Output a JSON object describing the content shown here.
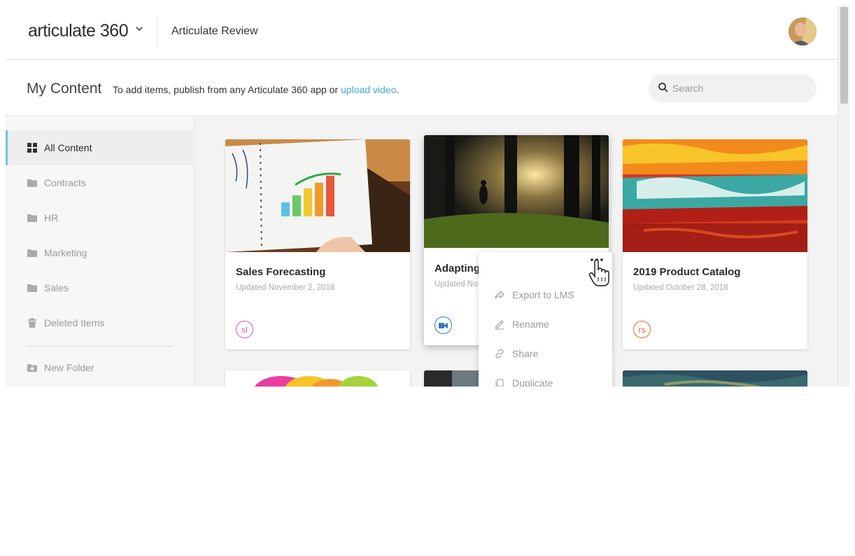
{
  "header": {
    "logo_text": "articulate 360",
    "app_title": "Articulate Review",
    "avatar_alt": "user-avatar"
  },
  "content_header": {
    "title": "My Content",
    "help_prefix": "To add items, publish from any Articulate 360 app or ",
    "help_link": "upload video",
    "help_suffix": ".",
    "search_placeholder": "Search"
  },
  "sidebar": {
    "items": [
      {
        "label": "All Content",
        "icon": "grid-icon",
        "active": true
      },
      {
        "label": "Contracts",
        "icon": "folder-icon",
        "active": false
      },
      {
        "label": "HR",
        "icon": "folder-icon",
        "active": false
      },
      {
        "label": "Marketing",
        "icon": "folder-icon",
        "active": false
      },
      {
        "label": "Sales",
        "icon": "folder-icon",
        "active": false
      },
      {
        "label": "Deleted Items",
        "icon": "trash-icon",
        "active": false
      }
    ],
    "new_folder": "New Folder"
  },
  "cards": [
    {
      "title": "Sales Forecasting",
      "date": "Updated November 2, 2018",
      "badge": "sl",
      "badge_color": "#c25bc2"
    },
    {
      "title": "Adapting",
      "date": "Updated No",
      "badge": "video-icon",
      "badge_color": "#3a79c9"
    },
    {
      "title": "2019 Product Catalog",
      "date": "Updated October 28, 2018",
      "badge": "rs",
      "badge_color": "#e0683a"
    }
  ],
  "card_menu": {
    "items": [
      {
        "label": "Export to LMS",
        "icon": "share-arrow-icon"
      },
      {
        "label": "Rename",
        "icon": "pencil-icon"
      },
      {
        "label": "Share",
        "icon": "link-icon"
      },
      {
        "label": "Duplicate",
        "icon": "copy-icon"
      }
    ]
  },
  "colors": {
    "accent": "#6ec3e6",
    "link": "#3fa8d8"
  }
}
